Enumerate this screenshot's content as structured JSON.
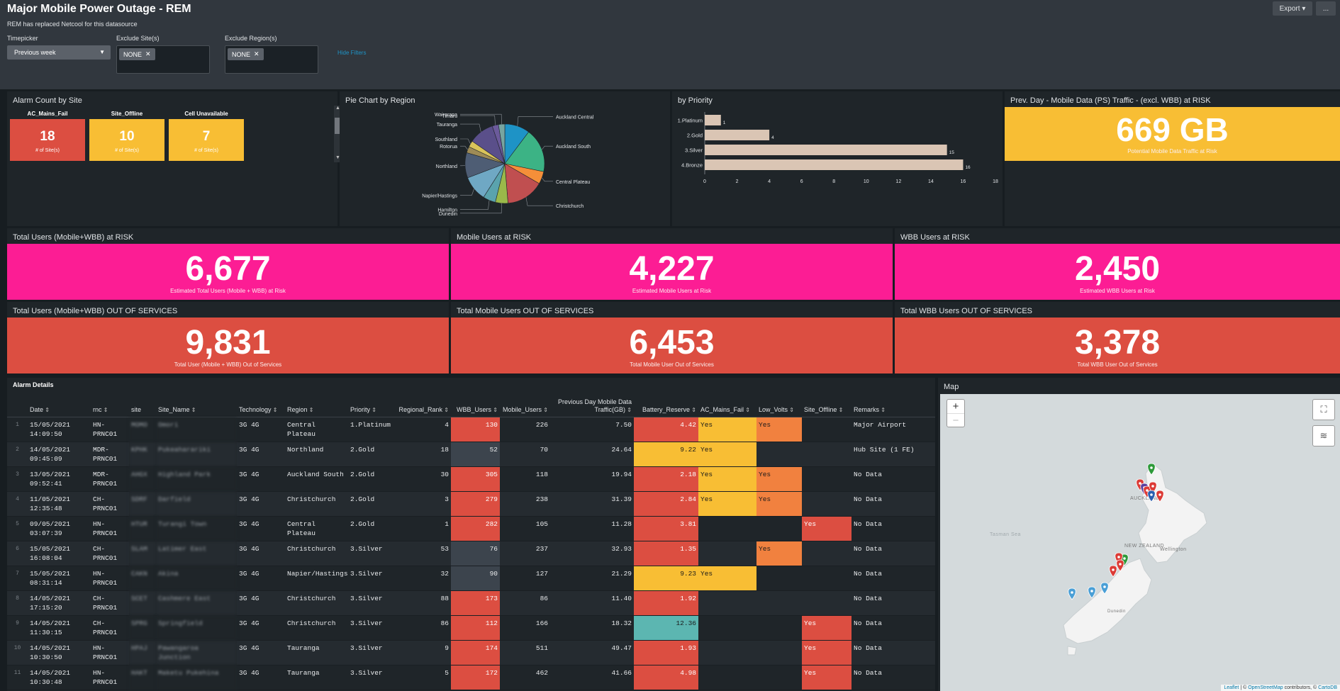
{
  "header": {
    "title": "Major Mobile Power Outage - REM",
    "description": "REM has replaced Netcool for this datasource",
    "export_label": "Export ▾",
    "more_label": "..."
  },
  "filters": {
    "timepicker": {
      "label": "Timepicker",
      "value": "Previous week"
    },
    "exclude_sites": {
      "label": "Exclude Site(s)",
      "chip": "NONE"
    },
    "exclude_regions": {
      "label": "Exclude Region(s)",
      "chip": "NONE"
    },
    "hide_filters": "Hide Filters"
  },
  "alarm_count": {
    "title": "Alarm Count by Site",
    "tiles": [
      {
        "label": "AC_Mains_Fail",
        "value": "18",
        "sub": "# of Site(s)",
        "color": "#dc4e41"
      },
      {
        "label": "Site_Offline",
        "value": "10",
        "sub": "# of Site(s)",
        "color": "#f8be34"
      },
      {
        "label": "Cell Unavailable",
        "value": "7",
        "sub": "# of Site(s)",
        "color": "#f8be34"
      }
    ]
  },
  "pie_chart": {
    "title": "Pie Chart by Region",
    "chart_data": {
      "type": "pie",
      "slices": [
        {
          "label": "Auckland Central",
          "value": 4
        },
        {
          "label": "Auckland South",
          "value": 7
        },
        {
          "label": "Central Plateau",
          "value": 2
        },
        {
          "label": "Christchurch",
          "value": 6
        },
        {
          "label": "Dunedin",
          "value": 2
        },
        {
          "label": "Hamilton",
          "value": 2
        },
        {
          "label": "Napier/Hastings",
          "value": 4
        },
        {
          "label": "Northland",
          "value": 4
        },
        {
          "label": "Rotorua",
          "value": 1
        },
        {
          "label": "Southland",
          "value": 1
        },
        {
          "label": "Tauranga",
          "value": 4
        },
        {
          "label": "Timaru",
          "value": 1
        },
        {
          "label": "Wairarapa",
          "value": 1
        }
      ],
      "colors": [
        "#1e93c6",
        "#3cb385",
        "#f58f39",
        "#c04f50",
        "#9ab94a",
        "#5aa3ad",
        "#6fa8c4",
        "#4e5d74",
        "#9e8b56",
        "#d9c45a",
        "#5a4f8a",
        "#6b5a9b",
        "#78a5a0"
      ]
    }
  },
  "priority_chart": {
    "title": "by Priority",
    "chart_data": {
      "type": "bar",
      "orientation": "horizontal",
      "categories": [
        "1.Platinum",
        "2.Gold",
        "3.Silver",
        "4.Bronze"
      ],
      "values": [
        1,
        4,
        15,
        16
      ],
      "xlim": [
        0,
        18
      ],
      "xticks": [
        0,
        2,
        4,
        6,
        8,
        10,
        12,
        14,
        16,
        18
      ],
      "bar_color": "#dac5b4"
    }
  },
  "traffic": {
    "title": "Prev. Day - Mobile Data (PS) Traffic - (excl. WBB) at RISK",
    "value": "669 GB",
    "sub": "Potential Mobile Data Traffic at Risk",
    "color": "#f8be34"
  },
  "risk_panels": [
    {
      "title": "Total Users (Mobile+WBB) at RISK",
      "value": "6,677",
      "sub": "Estimated Total Users (Mobile + WBB) at Risk",
      "color": "#fc1d94"
    },
    {
      "title": "Mobile Users at RISK",
      "value": "4,227",
      "sub": "Estimated Mobile Users at Risk",
      "color": "#fc1d94"
    },
    {
      "title": "WBB Users at RISK",
      "value": "2,450",
      "sub": "Estimated WBB Users at Risk",
      "color": "#fc1d94"
    }
  ],
  "oos_panels": [
    {
      "title": "Total Users (Mobile+WBB) OUT OF SERVICES",
      "value": "9,831",
      "sub": "Total User (Mobile + WBB) Out of Services",
      "color": "#dc4e41"
    },
    {
      "title": "Total Mobile Users OUT OF SERVICES",
      "value": "6,453",
      "sub": "Total Mobile User Out of Services",
      "color": "#dc4e41"
    },
    {
      "title": "Total WBB Users OUT OF SERVICES",
      "value": "3,378",
      "sub": "Total WBB User Out of Services",
      "color": "#dc4e41"
    }
  ],
  "alarm_details": {
    "title": "Alarm Details",
    "columns": [
      "",
      "Date",
      "rnc",
      "site",
      "Site_Name",
      "Technology",
      "Region",
      "Priority",
      "Regional_Rank",
      "WBB_Users",
      "Mobile_Users",
      "Previous Day Mobile Data Traffic(GB)",
      "Battery_Reserve",
      "AC_Mains_Fail",
      "Low_Volts",
      "Site_Offline",
      "Remarks"
    ],
    "rows": [
      [
        "1",
        "15/05/2021 14:09:50",
        "HN- PRNC01",
        "MOMO",
        "Omori",
        "3G 4G",
        "Central Plateau",
        "1.Platinum",
        "4",
        "130",
        "226",
        "7.50",
        "4.42",
        "Yes",
        "Yes",
        "",
        "Major Airport"
      ],
      [
        "2",
        "14/05/2021 09:45:09",
        "MDR- PRNC01",
        "KPHK",
        "Pukeaharariki",
        "3G 4G",
        "Northland",
        "2.Gold",
        "18",
        "52",
        "70",
        "24.64",
        "9.22",
        "Yes",
        "",
        "",
        "Hub Site (1 FE)"
      ],
      [
        "3",
        "13/05/2021 09:52:41",
        "MDR- PRNC01",
        "AHGX",
        "Highland Park",
        "3G 4G",
        "Auckland South",
        "2.Gold",
        "30",
        "305",
        "118",
        "19.94",
        "2.18",
        "Yes",
        "Yes",
        "",
        "No Data"
      ],
      [
        "4",
        "11/05/2021 12:35:48",
        "CH- PRNC01",
        "SDRF",
        "Darfield",
        "3G 4G",
        "Christchurch",
        "2.Gold",
        "3",
        "279",
        "238",
        "31.39",
        "2.84",
        "Yes",
        "Yes",
        "",
        "No Data"
      ],
      [
        "5",
        "09/05/2021 03:07:39",
        "HN- PRNC01",
        "HTUR",
        "Turangi Town",
        "3G 4G",
        "Central Plateau",
        "2.Gold",
        "1",
        "282",
        "105",
        "11.28",
        "3.81",
        "",
        "",
        "Yes",
        "No Data"
      ],
      [
        "6",
        "15/05/2021 16:08:04",
        "CH- PRNC01",
        "SLAM",
        "Latimer East",
        "3G 4G",
        "Christchurch",
        "3.Silver",
        "53",
        "76",
        "237",
        "32.93",
        "1.35",
        "",
        "Yes",
        "",
        "No Data"
      ],
      [
        "7",
        "15/05/2021 08:31:14",
        "HN- PRNC01",
        "CAKN",
        "Akina",
        "3G 4G",
        "Napier/Hastings",
        "3.Silver",
        "32",
        "90",
        "127",
        "21.29",
        "9.23",
        "Yes",
        "",
        "",
        "No Data"
      ],
      [
        "8",
        "14/05/2021 17:15:20",
        "CH- PRNC01",
        "SCET",
        "Cashmere East",
        "3G 4G",
        "Christchurch",
        "3.Silver",
        "88",
        "173",
        "86",
        "11.40",
        "1.92",
        "",
        "",
        "",
        "No Data"
      ],
      [
        "9",
        "14/05/2021 11:30:15",
        "CH- PRNC01",
        "SPRG",
        "Springfield",
        "3G 4G",
        "Christchurch",
        "3.Silver",
        "86",
        "112",
        "166",
        "18.32",
        "12.36",
        "",
        "",
        "Yes",
        "No Data"
      ],
      [
        "10",
        "14/05/2021 10:30:50",
        "HN- PRNC01",
        "HPAJ",
        "Pawangaroa Junction",
        "3G 4G",
        "Tauranga",
        "3.Silver",
        "9",
        "174",
        "511",
        "49.47",
        "1.93",
        "",
        "",
        "Yes",
        "No Data"
      ],
      [
        "11",
        "14/05/2021 10:30:48",
        "HN- PRNC01",
        "HAKT",
        "Maketu Pukehina",
        "3G 4G",
        "Tauranga",
        "3.Silver",
        "5",
        "172",
        "462",
        "41.66",
        "4.98",
        "",
        "",
        "Yes",
        "No Data"
      ]
    ],
    "cell_colors": {
      "wbb": [
        "red",
        "grey",
        "red",
        "red",
        "red",
        "grey",
        "grey",
        "red",
        "red",
        "red",
        "red"
      ],
      "battery": [
        "red",
        "yellow",
        "red",
        "red",
        "red",
        "red",
        "yellow",
        "red",
        "teal",
        "red",
        "red"
      ],
      "ac": [
        "yellow",
        "yellow",
        "yellow",
        "yellow",
        "",
        "",
        "yellow",
        "",
        "",
        "",
        ""
      ],
      "lowvolts": [
        "orange",
        "",
        "orange",
        "orange",
        "",
        "orange",
        "",
        "",
        "",
        "",
        ""
      ],
      "offline": [
        "",
        "",
        "",
        "",
        "red",
        "",
        "",
        "",
        "red",
        "red",
        "red"
      ]
    }
  },
  "map": {
    "title": "Map",
    "labels": {
      "auckland": "AUCKLAND",
      "nz": "NEW ZEALAND",
      "wellington": "Wellington",
      "dunedin": "Dunedin",
      "tasman": "Tasman Sea"
    },
    "attribution": {
      "leaflet": "Leaflet",
      "osm": "OpenStreetMap",
      "contrib": "contributors, ©",
      "carto": "CartoDB"
    }
  }
}
